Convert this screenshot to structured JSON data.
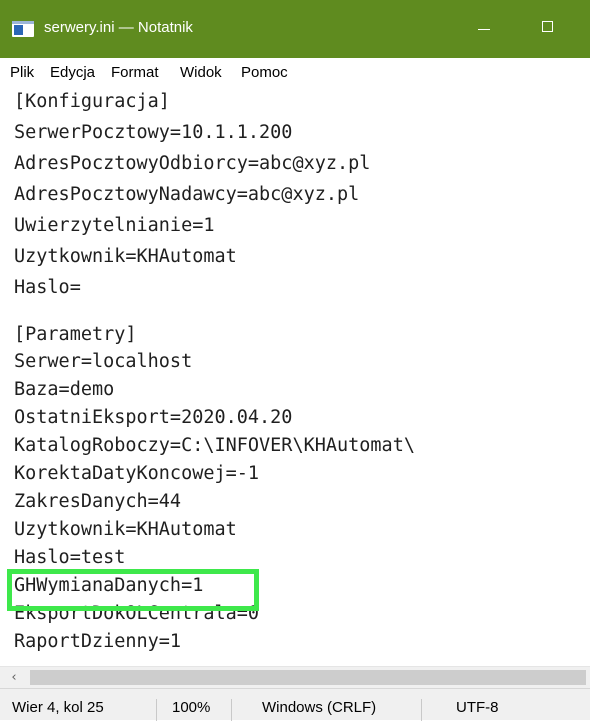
{
  "window": {
    "title": "serwery.ini — Notatnik",
    "icon": "notepad-icon",
    "accent_color": "#5f8b1f"
  },
  "menu": [
    "Plik",
    "Edycja",
    "Format",
    "Widok",
    "Pomoc"
  ],
  "editor": {
    "lines": [
      "[Konfiguracja]",
      "SerwerPocztowy=10.1.1.200",
      "AdresPocztowyOdbiorcy=abc@xyz.pl",
      "AdresPocztowyNadawcy=abc@xyz.pl",
      "Uwierzytelnianie=1",
      "Uzytkownik=KHAutomat",
      "Haslo=",
      "",
      "[Parametry]",
      "Serwer=localhost",
      "Baza=demo",
      "OstatniEksport=2020.04.20",
      "KatalogRoboczy=C:\\INFOVER\\KHAutomat\\",
      "KorektaDatyKoncowej=-1",
      "ZakresDanych=44",
      "Uzytkownik=KHAutomat",
      "Haslo=test",
      "GHWymianaDanych=1",
      "EksportDokOLCentrala=0",
      "RaportDzienny=1"
    ],
    "highlight_color": "#3ee84b"
  },
  "scrollbar": {
    "left_arrow": "‹"
  },
  "status": {
    "position": "Wier 4, kol 25",
    "zoom": "100%",
    "line_endings": "Windows (CRLF)",
    "encoding": "UTF-8"
  }
}
